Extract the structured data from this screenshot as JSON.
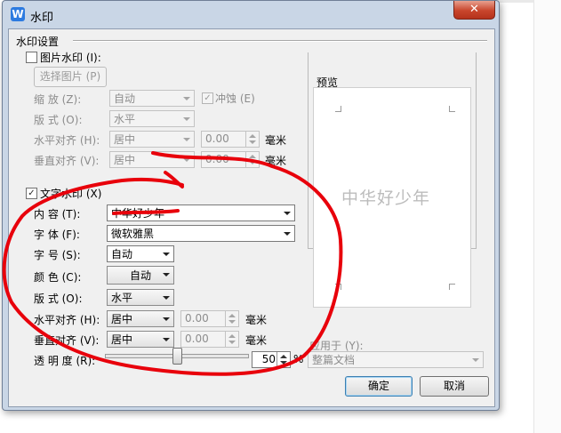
{
  "window": {
    "title": "水印",
    "close_glyph": "✕",
    "app_icon_letter": "W"
  },
  "section_title": "水印设置",
  "picture": {
    "checkbox_label": "图片水印 (I):",
    "select_button": "选择图片 (P)",
    "scale_label": "缩 放 (Z):",
    "scale_value": "自动",
    "washout_label": "冲蚀 (E)",
    "layout_label": "版 式 (O):",
    "layout_value": "水平",
    "halign_label": "水平对齐 (H):",
    "halign_value": "居中",
    "halign_offset": "0.00",
    "valign_label": "垂直对齐 (V):",
    "valign_value": "居中",
    "valign_offset": "0.00",
    "unit": "毫米"
  },
  "text": {
    "checkbox_label": "文字水印 (X)",
    "content_label": "内 容 (T):",
    "content_value": "中华好少年",
    "font_label": "字 体 (F):",
    "font_value": "微软雅黑",
    "size_label": "字 号 (S):",
    "size_value": "自动",
    "color_label": "颜 色 (C):",
    "color_value": "自动",
    "layout_label": "版 式 (O):",
    "layout_value": "水平",
    "halign_label": "水平对齐 (H):",
    "halign_value": "居中",
    "halign_offset": "0.00",
    "valign_label": "垂直对齐 (V):",
    "valign_value": "居中",
    "valign_offset": "0.00",
    "unit": "毫米",
    "transparency_label": "透 明 度 (R):",
    "transparency_value": "50",
    "transparency_percent": 50,
    "percent_sign": "%"
  },
  "preview": {
    "label": "预览",
    "watermark_text": "中华好少年"
  },
  "apply_to": {
    "label": "应用于 (Y):",
    "value": "整篇文档"
  },
  "buttons": {
    "ok": "确定",
    "cancel": "取消"
  },
  "colors": {
    "annotation": "#e8000b",
    "close_button": "#c8452c",
    "accent": "#2d7be0"
  }
}
